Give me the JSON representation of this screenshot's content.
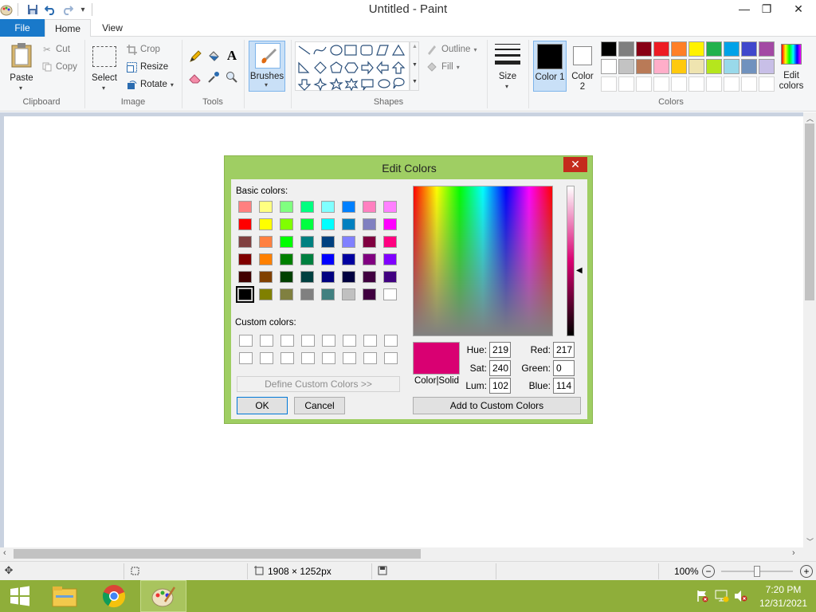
{
  "window": {
    "title": "Untitled - Paint",
    "quick_access_icons": [
      "paint-app-icon",
      "save-icon",
      "undo-icon",
      "redo-icon",
      "customize-dropdown-icon"
    ]
  },
  "tabs": [
    {
      "label": "File"
    },
    {
      "label": "Home"
    },
    {
      "label": "View"
    }
  ],
  "ribbon": {
    "clipboard": {
      "paste": "Paste",
      "cut": "Cut",
      "copy": "Copy",
      "group": "Clipboard"
    },
    "image": {
      "select": "Select",
      "crop": "Crop",
      "resize": "Resize",
      "rotate": "Rotate",
      "group": "Image"
    },
    "tools": {
      "group": "Tools"
    },
    "brushes": {
      "label": "Brushes"
    },
    "shapes": {
      "outline": "Outline",
      "fill": "Fill",
      "group": "Shapes"
    },
    "size": {
      "label": "Size"
    },
    "color1": {
      "label": "Color 1",
      "color": "#000000"
    },
    "color2": {
      "label": "Color 2",
      "color": "#ffffff"
    },
    "colors": {
      "group": "Colors",
      "edit_label": "Edit colors"
    },
    "palette_row1": [
      "#000000",
      "#7f7f7f",
      "#880015",
      "#ed1c24",
      "#ff7f27",
      "#fff200",
      "#22b14c",
      "#00a2e8",
      "#3f48cc",
      "#a349a4"
    ],
    "palette_row2": [
      "#ffffff",
      "#c3c3c3",
      "#b97a57",
      "#ffaec9",
      "#ffc90e",
      "#efe4b0",
      "#b5e61d",
      "#99d9ea",
      "#7092be",
      "#c8bfe7"
    ]
  },
  "status": {
    "dimensions": "1908 × 1252px",
    "zoom": "100%"
  },
  "taskbar": {
    "time": "7:20 PM",
    "date": "12/31/2021"
  },
  "dialog": {
    "title": "Edit Colors",
    "basic_colors_label": "Basic colors:",
    "custom_colors_label": "Custom colors:",
    "define_custom_label": "Define Custom Colors >>",
    "ok_label": "OK",
    "cancel_label": "Cancel",
    "add_custom_label": "Add to Custom Colors",
    "color_solid_label": "Color|Solid",
    "preview_color": "#d90072",
    "hue_label": "Hue:",
    "hue": "219",
    "sat_label": "Sat:",
    "sat": "240",
    "lum_label": "Lum:",
    "lum": "102",
    "red_label": "Red:",
    "red": "217",
    "green_label": "Green:",
    "green": "0",
    "blue_label": "Blue:",
    "blue": "114",
    "basic_colors": [
      [
        "#ff8080",
        "#ffff80",
        "#80ff80",
        "#00ff80",
        "#80ffff",
        "#0080ff",
        "#ff80c0",
        "#ff80ff"
      ],
      [
        "#ff0000",
        "#ffff00",
        "#80ff00",
        "#00ff40",
        "#00ffff",
        "#0080c0",
        "#8080c0",
        "#ff00ff"
      ],
      [
        "#804040",
        "#ff8040",
        "#00ff00",
        "#008080",
        "#004080",
        "#8080ff",
        "#800040",
        "#ff0080"
      ],
      [
        "#800000",
        "#ff8000",
        "#008000",
        "#008040",
        "#0000ff",
        "#0000a0",
        "#800080",
        "#8000ff"
      ],
      [
        "#400000",
        "#804000",
        "#004000",
        "#004040",
        "#000080",
        "#000040",
        "#400040",
        "#400080"
      ],
      [
        "#000000",
        "#808000",
        "#808040",
        "#808080",
        "#408080",
        "#c0c0c0",
        "#400040",
        "#ffffff"
      ]
    ]
  }
}
